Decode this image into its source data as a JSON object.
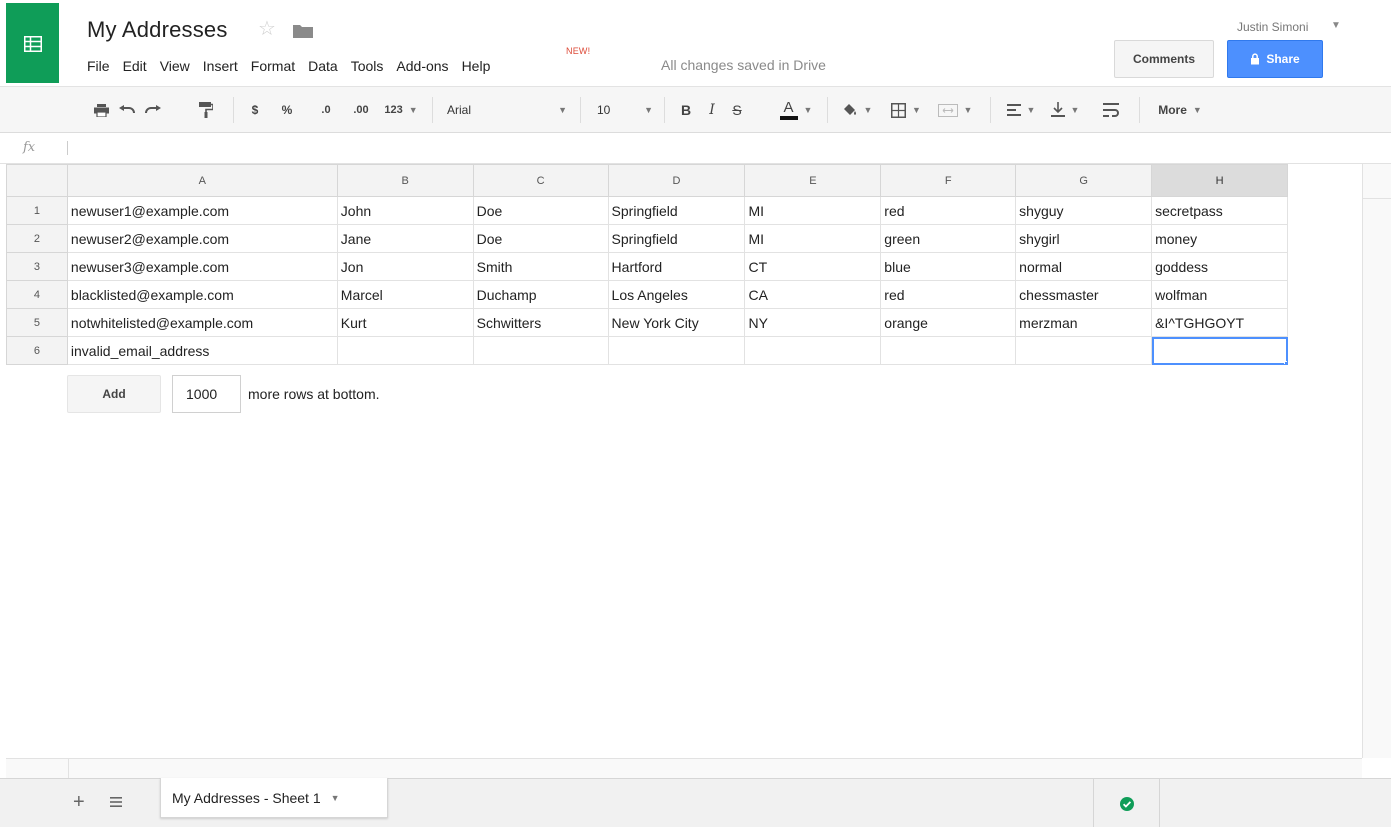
{
  "header": {
    "title": "My Addresses",
    "save_status": "All changes saved in Drive",
    "new_badge": "NEW!",
    "user_name": "Justin Simoni",
    "comments_label": "Comments",
    "share_label": "Share",
    "brand_color": "#0f9d58",
    "share_color": "#4d90fe"
  },
  "menu": [
    "File",
    "Edit",
    "View",
    "Insert",
    "Format",
    "Data",
    "Tools",
    "Add-ons",
    "Help"
  ],
  "toolbar": {
    "currency": "$",
    "percent": "%",
    "decimal_decrease": ".0",
    "decimal_increase": ".00",
    "more_formats": "123",
    "font": "Arial",
    "font_size": "10",
    "bold": "B",
    "italic": "I",
    "strikethrough": "S",
    "text_color_label": "A",
    "more": "More",
    "icons": [
      "print-icon",
      "undo-icon",
      "redo-icon",
      "paint-format-icon",
      "fill-color-icon",
      "borders-icon",
      "merge-cells-icon",
      "align-icon",
      "valign-icon",
      "wrap-icon"
    ]
  },
  "formula_bar": {
    "icon": "fx",
    "value": ""
  },
  "grid": {
    "columns": [
      "A",
      "B",
      "C",
      "D",
      "E",
      "F",
      "G",
      "H"
    ],
    "selected_column": "H",
    "selected_cell": "H6",
    "rows": [
      {
        "num": "1",
        "cells": [
          "newuser1@example.com",
          "John",
          "Doe",
          "Springfield",
          "MI",
          "red",
          "shyguy",
          "secretpass"
        ]
      },
      {
        "num": "2",
        "cells": [
          "newuser2@example.com",
          "Jane",
          "Doe",
          "Springfield",
          "MI",
          "green",
          "shygirl",
          "money"
        ]
      },
      {
        "num": "3",
        "cells": [
          "newuser3@example.com",
          "Jon",
          "Smith",
          "Hartford",
          "CT",
          "blue",
          "normal",
          "goddess"
        ]
      },
      {
        "num": "4",
        "cells": [
          "blacklisted@example.com",
          "Marcel",
          "Duchamp",
          "Los Angeles",
          "CA",
          "red",
          "chessmaster",
          "wolfman"
        ]
      },
      {
        "num": "5",
        "cells": [
          "notwhitelisted@example.com",
          "Kurt",
          "Schwitters",
          "New York City",
          "NY",
          "orange",
          "merzman",
          "&I^TGHGOYT"
        ]
      },
      {
        "num": "6",
        "cells": [
          "invalid_email_address",
          "",
          "",
          "",
          "",
          "",
          "",
          ""
        ]
      }
    ]
  },
  "add_rows": {
    "button_label": "Add",
    "count": "1000",
    "suffix": "more rows at bottom."
  },
  "sheets": {
    "active_tab": "My Addresses - Sheet 1",
    "add_icon": "plus-icon",
    "list_icon": "sheet-list-icon",
    "status_icon": "check-circle-icon",
    "status_color": "#0f9d58"
  }
}
